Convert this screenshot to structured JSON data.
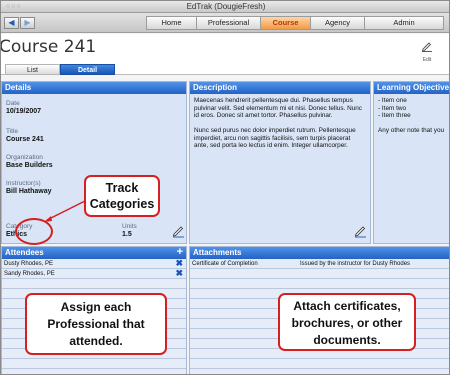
{
  "window": {
    "title": "EdTrak (DougieFresh)"
  },
  "nav": {
    "back_glyph": "◀",
    "forward_glyph": "▶",
    "tabs": [
      {
        "label": "Home"
      },
      {
        "label": "Professional"
      },
      {
        "label": "Course"
      },
      {
        "label": "Agency"
      },
      {
        "label": "Admin"
      }
    ],
    "active_tab": "Course"
  },
  "header": {
    "title": "Course 241",
    "edit_label": "Edit",
    "edit_icon": "pencil-icon"
  },
  "subtabs": {
    "list": "List",
    "detail": "Detail"
  },
  "details": {
    "heading": "Details",
    "date_label": "Date",
    "date_value": "10/19/2007",
    "title_label": "Title",
    "title_value": "Course 241",
    "org_label": "Organization",
    "org_value": "Base Builders",
    "instructor_label": "Instructor(s)",
    "instructor_value": "Bill Hathaway",
    "category_label": "Category",
    "category_value": "Ethics",
    "units_label": "Units",
    "units_value": "1.5"
  },
  "description": {
    "heading": "Description",
    "para1": "Maecenas hendrerit pellentesque dui. Phasellus tempus pulvinar velit. Sed elementum mi et nisi. Donec tellus. Nunc id eros. Donec sit amet tortor. Phasellus pulvinar.",
    "para2": "Nunc sed purus nec dolor imperdiet rutrum. Pellentesque imperdiet, arcu non sagittis facilisis, sem turpis placerat ante, sed porta leo lectus id enim. Integer ullamcorper."
  },
  "learning": {
    "heading": "Learning Objectives",
    "items": [
      "- Item one",
      "- Item two",
      "- Item three"
    ],
    "note": "Any other note that you"
  },
  "attendees": {
    "heading": "Attendees",
    "add_glyph": "+",
    "remove_glyph": "✖",
    "rows": [
      "Dusty Rhodes, PE",
      "Sandy Rhodes, PE"
    ]
  },
  "attachments": {
    "heading": "Attachments",
    "rows": [
      {
        "name": "Certificate of Completion",
        "note": "Issued by the instructor for Dusty Rhodes"
      }
    ]
  },
  "callouts": {
    "track": "Track Categories",
    "assign": "Assign each Professional that attended.",
    "attach": "Attach certificates, brochures, or other documents."
  },
  "colors": {
    "panel_header": "#2a6ad0",
    "active_tab": "#f29b45",
    "callout_border": "#d42020"
  }
}
